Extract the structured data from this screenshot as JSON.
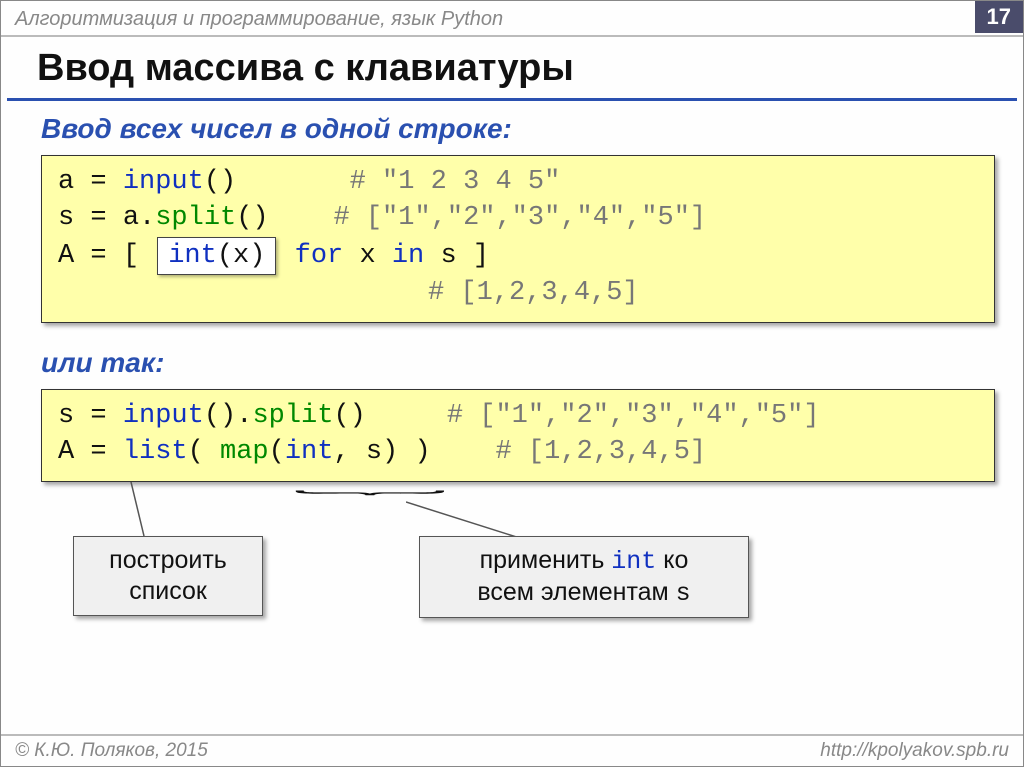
{
  "header": {
    "topic": "Алгоритмизация и программирование, язык Python",
    "page": "17"
  },
  "title": "Ввод массива с клавиатуры",
  "sub1": "Ввод всех чисел в одной строке:",
  "code1": {
    "l1a": "a",
    "l1eq": " = ",
    "l1b": "input",
    "l1c": "()",
    "l1cm": "# \"1 2 3 4 5\"",
    "l2a": "s",
    "l2eq": " = ",
    "l2b": "a.",
    "l2c": "split",
    "l2d": "()",
    "l2cm": "# [\"1\",\"2\",\"3\",\"4\",\"5\"]",
    "l3a": "A",
    "l3eq": " = ",
    "l3b": "[ ",
    "l3int": "int",
    "l3intx": "(x)",
    "l3c": " for",
    "l3d": " x ",
    "l3e": "in",
    "l3f": " s ]",
    "l4cm": "# [1,2,3,4,5]"
  },
  "alt_label": "или так:",
  "code2": {
    "l1a": "s",
    "l1eq": " = ",
    "l1b": "input",
    "l1c": "().",
    "l1d": "split",
    "l1e": "()",
    "l1cm": "# [\"1\",\"2\",\"3\",\"4\",\"5\"]",
    "l2a": "A",
    "l2eq": " = ",
    "l2b": "list",
    "l2c": "( ",
    "l2d": "map",
    "l2e": "(",
    "l2f": "int",
    "l2g": ", s) )",
    "l2cm": "# [1,2,3,4,5]"
  },
  "callout1": {
    "line1": "построить",
    "line2": "список"
  },
  "callout2": {
    "pre": "применить ",
    "code": "int",
    "mid": " ко",
    "line2a": "всем элементам ",
    "line2b": "s"
  },
  "footer": {
    "left": "© К.Ю. Поляков, 2015",
    "right": "http://kpolyakov.spb.ru"
  }
}
